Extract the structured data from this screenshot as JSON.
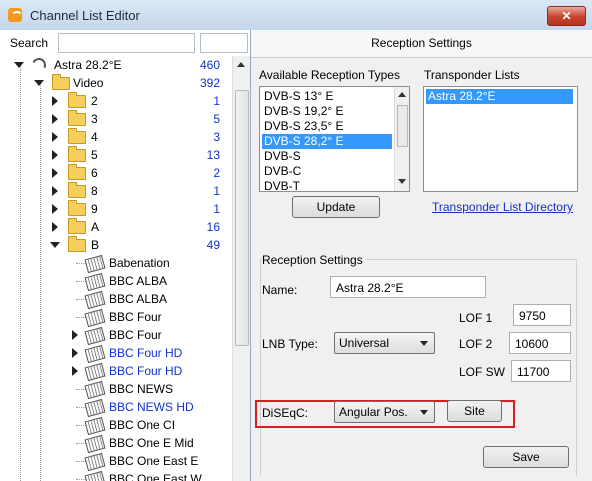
{
  "window": {
    "title": "Channel List Editor",
    "close_glyph": "✕"
  },
  "search": {
    "label": "Search",
    "value": ""
  },
  "tree": {
    "root": {
      "label": "Astra 28.2°E",
      "count": "460"
    },
    "video": {
      "label": "Video",
      "count": "392"
    },
    "folders": [
      {
        "label": "2",
        "count": "1"
      },
      {
        "label": "3",
        "count": "5"
      },
      {
        "label": "4",
        "count": "3"
      },
      {
        "label": "5",
        "count": "13"
      },
      {
        "label": "6",
        "count": "2"
      },
      {
        "label": "8",
        "count": "1"
      },
      {
        "label": "9",
        "count": "1"
      },
      {
        "label": "A",
        "count": "16"
      },
      {
        "label": "B",
        "count": "49"
      }
    ],
    "channels": [
      {
        "label": "Babenation",
        "expandable": false,
        "blue": false
      },
      {
        "label": "BBC ALBA",
        "expandable": false,
        "blue": false
      },
      {
        "label": "BBC ALBA",
        "expandable": false,
        "blue": false
      },
      {
        "label": "BBC Four",
        "expandable": false,
        "blue": false
      },
      {
        "label": "BBC Four",
        "expandable": true,
        "blue": false
      },
      {
        "label": "BBC Four HD",
        "expandable": true,
        "blue": true
      },
      {
        "label": "BBC Four HD",
        "expandable": true,
        "blue": true
      },
      {
        "label": "BBC NEWS",
        "expandable": false,
        "blue": false
      },
      {
        "label": "BBC NEWS HD",
        "expandable": false,
        "blue": true
      },
      {
        "label": "BBC One CI",
        "expandable": false,
        "blue": false
      },
      {
        "label": "BBC One E Mid",
        "expandable": false,
        "blue": false
      },
      {
        "label": "BBC One East E",
        "expandable": false,
        "blue": false
      },
      {
        "label": "BBC One East W",
        "expandable": false,
        "blue": false
      }
    ]
  },
  "right": {
    "header": "Reception Settings",
    "available_label": "Available Reception Types",
    "available_items": [
      "DVB-S 13° E",
      "DVB-S 19,2° E",
      "DVB-S 23,5° E",
      "DVB-S 28,2° E",
      "DVB-S",
      "DVB-C",
      "DVB-T"
    ],
    "available_selected": 3,
    "transponder_label": "Transponder Lists",
    "transponder_items": [
      "Astra 28.2°E"
    ],
    "update_button": "Update",
    "transponder_link": "Transponder List Directory",
    "group_title": "Reception Settings",
    "name_label": "Name:",
    "name_value": "Astra 28.2°E",
    "lnb_label": "LNB Type:",
    "lnb_value": "Universal",
    "lof1_label": "LOF 1",
    "lof1_value": "9750",
    "lof2_label": "LOF 2",
    "lof2_value": "10600",
    "lofsw_label": "LOF SW",
    "lofsw_value": "11700",
    "diseqc_label": "DiSEqC:",
    "diseqc_value": "Angular Pos.",
    "site_button": "Site",
    "save_button": "Save"
  },
  "colors": {
    "accent": "#3399ff",
    "link": "#1133cc",
    "highlight_box": "#d42020"
  }
}
